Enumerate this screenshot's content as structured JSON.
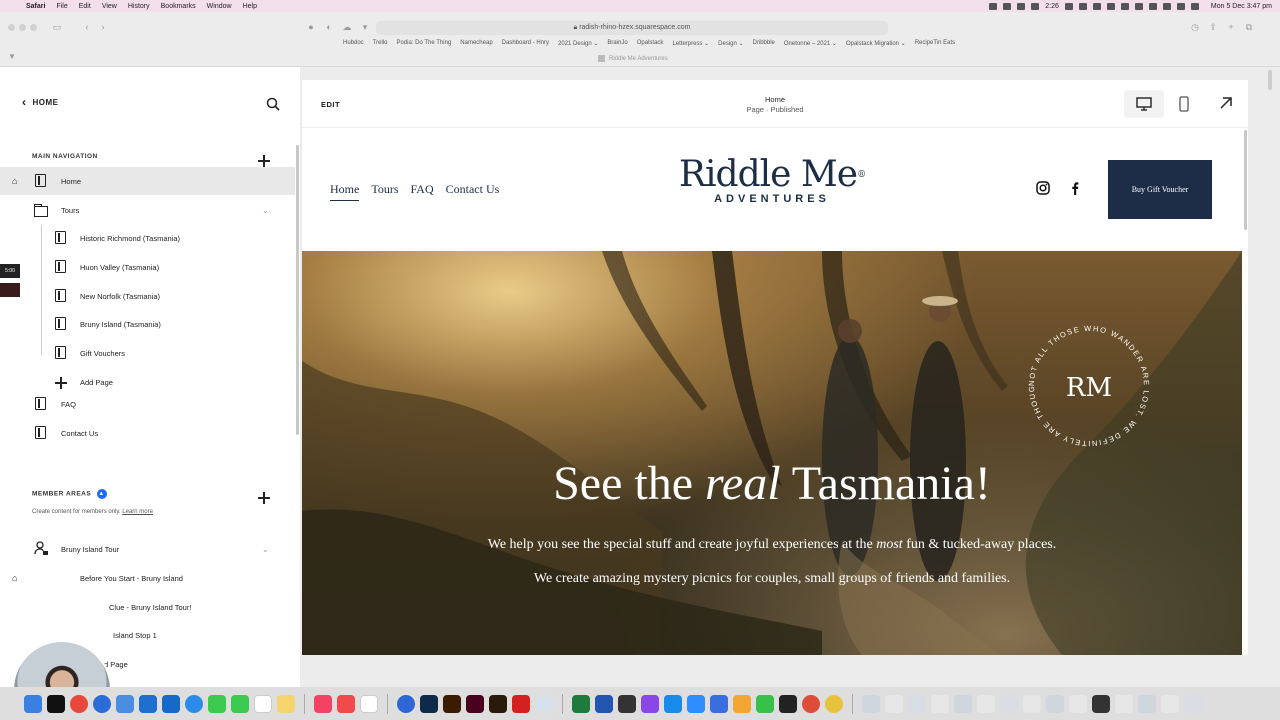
{
  "menubar": {
    "app": "Safari",
    "items": [
      "File",
      "Edit",
      "View",
      "History",
      "Bookmarks",
      "Window",
      "Help"
    ],
    "clock": "Mon 5 Dec  3:47 pm",
    "tray_time": "2:26"
  },
  "browser": {
    "url": "radish-rhino-hzex.squarespace.com",
    "bookmarks": [
      "Hubdoc",
      "Trello",
      "Podia: Do The Thing",
      "Namecheap",
      "Dashboard - Hnry",
      "2021 Design ⌄",
      "BrainJo",
      "Opalstack",
      "Letterpress ⌄",
      "Design ⌄",
      "Dribbble",
      "Onetonne – 2021 ⌄",
      "Opalstack Migration ⌄",
      "RecipeTin Eats"
    ],
    "tab_title": "Riddle Me Adventures"
  },
  "panel": {
    "back_label": "HOME",
    "main_nav_label": "MAIN NAVIGATION",
    "nav_items": [
      {
        "label": "Home"
      },
      {
        "label": "Tours"
      },
      {
        "label": "Historic Richmond (Tasmania)"
      },
      {
        "label": "Huon Valley (Tasmania)"
      },
      {
        "label": "New Norfolk (Tasmania)"
      },
      {
        "label": "Bruny Island (Tasmania)"
      },
      {
        "label": "Gift Vouchers"
      },
      {
        "label": "Add Page"
      },
      {
        "label": "FAQ"
      },
      {
        "label": "Contact Us"
      }
    ],
    "member_areas_label": "MEMBER AREAS",
    "member_help": "Create content for members only.",
    "member_learn_more": "Learn more",
    "member_items": [
      {
        "label": "Bruny Island Tour"
      },
      {
        "label": "Before You Start - Bruny Island"
      },
      {
        "label": "Clue - Bruny Island Tour!"
      },
      {
        "label": "Island Stop 1"
      },
      {
        "label": "d Page"
      }
    ],
    "side_timer": "5:00"
  },
  "preview": {
    "edit_label": "EDIT",
    "page_name": "Home",
    "page_status": "Page · Published",
    "site_nav": [
      "Home",
      "Tours",
      "FAQ",
      "Contact Us"
    ],
    "logo_main": "Riddle Me",
    "logo_reg": "®",
    "logo_sub": "ADVENTURES",
    "buy_button": "Buy Gift Voucher",
    "hero_title_1": "See the ",
    "hero_title_em": "real",
    "hero_title_2": " Tasmania!",
    "hero_line1_a": "We help you see the special stuff and create joyful experiences at the ",
    "hero_line1_em": "most",
    "hero_line1_b": " fun & tucked-away places.",
    "hero_line2": "We create amazing mystery picnics for couples, small groups of friends and families.",
    "stamp_monogram": "RM",
    "stamp_text": "NOT ALL THOSE WHO WANDER ARE LOST. WE DEFINITELY ARE THOUGH."
  },
  "colors": {
    "brand_navy": "#1d2d48",
    "accent_blue": "#1a6aff",
    "menubar_bg": "#f3dfe9"
  }
}
